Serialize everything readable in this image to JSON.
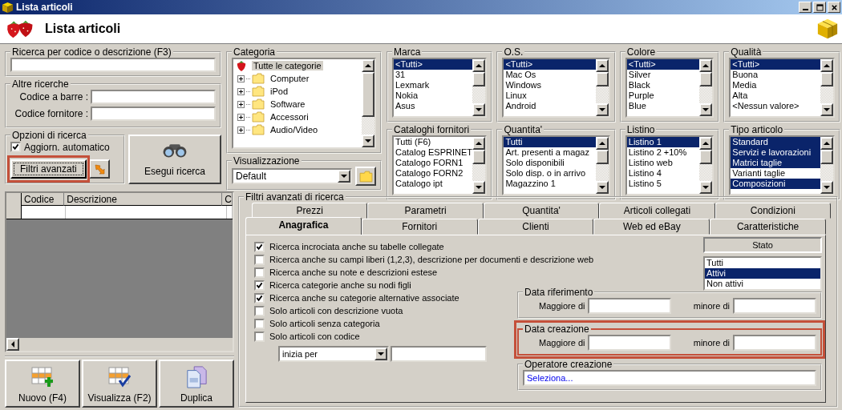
{
  "window": {
    "title": "Lista articoli"
  },
  "header": {
    "title": "Lista articoli"
  },
  "search": {
    "label": "Ricerca per codice o descrizione (F3)"
  },
  "other_searches": {
    "label": "Altre ricerche",
    "fields": [
      {
        "label": "Codice a barre :"
      },
      {
        "label": "Codice fornitore :"
      }
    ]
  },
  "options": {
    "label": "Opzioni di ricerca",
    "auto_update": {
      "label": "Aggiorn. automatico",
      "checked": true
    },
    "advanced_button": "Filtri avanzati"
  },
  "run_button": "Esegui ricerca",
  "category": {
    "label": "Categoria",
    "root": {
      "label": "Tutte le categorie",
      "selected": true,
      "children": [
        {
          "label": "Computer",
          "expanded": false,
          "selected": false
        },
        {
          "label": "iPod",
          "expanded": false,
          "selected": false
        },
        {
          "label": "Software",
          "expanded": false,
          "selected": false
        },
        {
          "label": "Accessori",
          "expanded": false,
          "selected": false
        },
        {
          "label": "Audio/Video",
          "expanded": false,
          "selected": false
        }
      ]
    }
  },
  "view": {
    "label": "Visualizzazione",
    "value": "Default"
  },
  "filters": [
    {
      "label": "Marca",
      "items": [
        {
          "text": "<Tutti>",
          "selected": true
        },
        {
          "text": "31",
          "selected": false
        },
        {
          "text": "Lexmark",
          "selected": false
        },
        {
          "text": "Nokia",
          "selected": false
        },
        {
          "text": "Asus",
          "selected": false
        }
      ]
    },
    {
      "label": "O.S.",
      "items": [
        {
          "text": "<Tutti>",
          "selected": true
        },
        {
          "text": "Mac Os",
          "selected": false
        },
        {
          "text": "Windows",
          "selected": false
        },
        {
          "text": "Linux",
          "selected": false
        },
        {
          "text": "Android",
          "selected": false
        }
      ]
    },
    {
      "label": "Colore",
      "items": [
        {
          "text": "<Tutti>",
          "selected": true
        },
        {
          "text": "Silver",
          "selected": false
        },
        {
          "text": "Black",
          "selected": false
        },
        {
          "text": "Purple",
          "selected": false
        },
        {
          "text": "Blue",
          "selected": false
        }
      ]
    },
    {
      "label": "Qualità",
      "items": [
        {
          "text": "<Tutti>",
          "selected": true
        },
        {
          "text": "Buona",
          "selected": false
        },
        {
          "text": "Media",
          "selected": false
        },
        {
          "text": "Alta",
          "selected": false
        },
        {
          "text": "<Nessun valore>",
          "selected": false
        }
      ]
    },
    {
      "label": "Cataloghi fornitori",
      "items": [
        {
          "text": "Tutti (F6)",
          "selected": false
        },
        {
          "text": "Catalog ESPRINET",
          "selected": false
        },
        {
          "text": "Catalogo FORN1",
          "selected": false
        },
        {
          "text": "Catalogo FORN2",
          "selected": false
        },
        {
          "text": "Catalogo ipt",
          "selected": false
        }
      ]
    },
    {
      "label": "Quantita'",
      "items": [
        {
          "text": "Tutti",
          "selected": true
        },
        {
          "text": "Art. presenti a magaz",
          "selected": false
        },
        {
          "text": "Solo disponibili",
          "selected": false
        },
        {
          "text": "Solo disp. o in arrivo",
          "selected": false
        },
        {
          "text": "Magazzino 1",
          "selected": false
        }
      ]
    },
    {
      "label": "Listino",
      "items": [
        {
          "text": "Listino 1",
          "selected": true
        },
        {
          "text": "Listino 2 +10%",
          "selected": false
        },
        {
          "text": "Listino web",
          "selected": false
        },
        {
          "text": "Listino 4",
          "selected": false
        },
        {
          "text": "Listino 5",
          "selected": false
        }
      ]
    },
    {
      "label": "Tipo articolo",
      "items": [
        {
          "text": "Standard",
          "selected": true
        },
        {
          "text": "Servizi e lavorazioni",
          "selected": true
        },
        {
          "text": "Matrici taglie",
          "selected": true
        },
        {
          "text": "Varianti taglie",
          "selected": false
        },
        {
          "text": "Composizioni",
          "selected": true
        }
      ]
    }
  ],
  "table": {
    "columns": [
      "Codice",
      "Descrizione",
      "C"
    ]
  },
  "actions": [
    {
      "label": "Nuovo (F4)",
      "kind": "new"
    },
    {
      "label": "Visualizza (F2)",
      "kind": "view"
    },
    {
      "label": "Duplica",
      "kind": "duplicate"
    }
  ],
  "advanced": {
    "label": "Filtri avanzati di ricerca",
    "tab_rows": [
      {
        "tabs": [
          {
            "label": "Prezzi",
            "selected": false
          },
          {
            "label": "Parametri",
            "selected": false
          },
          {
            "label": "Quantita'",
            "selected": false
          },
          {
            "label": "Articoli collegati",
            "selected": false
          },
          {
            "label": "Condizioni",
            "selected": false
          }
        ]
      },
      {
        "tabs": [
          {
            "label": "Anagrafica",
            "selected": true
          },
          {
            "label": "Fornitori",
            "selected": false
          },
          {
            "label": "Clienti",
            "selected": false
          },
          {
            "label": "Web ed eBay",
            "selected": false
          },
          {
            "label": "Caratteristiche",
            "selected": false
          }
        ]
      }
    ],
    "checks": [
      {
        "label": "Ricerca incrociata anche su tabelle collegate",
        "checked": true
      },
      {
        "label": "Ricerca anche su campi liberi (1,2,3), descrizione per documenti e descrizione web",
        "checked": false
      },
      {
        "label": "Ricerca anche su note e descrizioni estese",
        "checked": false
      },
      {
        "label": "Ricerca categorie anche su nodi figli",
        "checked": true
      },
      {
        "label": "Ricerca anche su categorie alternative associate",
        "checked": true
      },
      {
        "label": "Solo articoli con descrizione vuota",
        "checked": false
      },
      {
        "label": "Solo articoli senza categoria",
        "checked": false
      },
      {
        "label": "Solo articoli con codice",
        "checked": false
      }
    ],
    "match": {
      "value": "inizia per"
    },
    "stato": {
      "label": "Stato",
      "items": [
        {
          "text": "Tutti",
          "selected": false
        },
        {
          "text": "Attivi",
          "selected": true
        },
        {
          "text": "Non attivi",
          "selected": false
        }
      ]
    },
    "date_groups": [
      {
        "label": "Data riferimento",
        "from": "Maggiore di",
        "to": "minore di",
        "highlighted": false
      },
      {
        "label": "Data creazione",
        "from": "Maggiore di",
        "to": "minore di",
        "highlighted": true
      }
    ],
    "operator": {
      "label": "Operatore creazione",
      "value": "Seleziona..."
    }
  }
}
